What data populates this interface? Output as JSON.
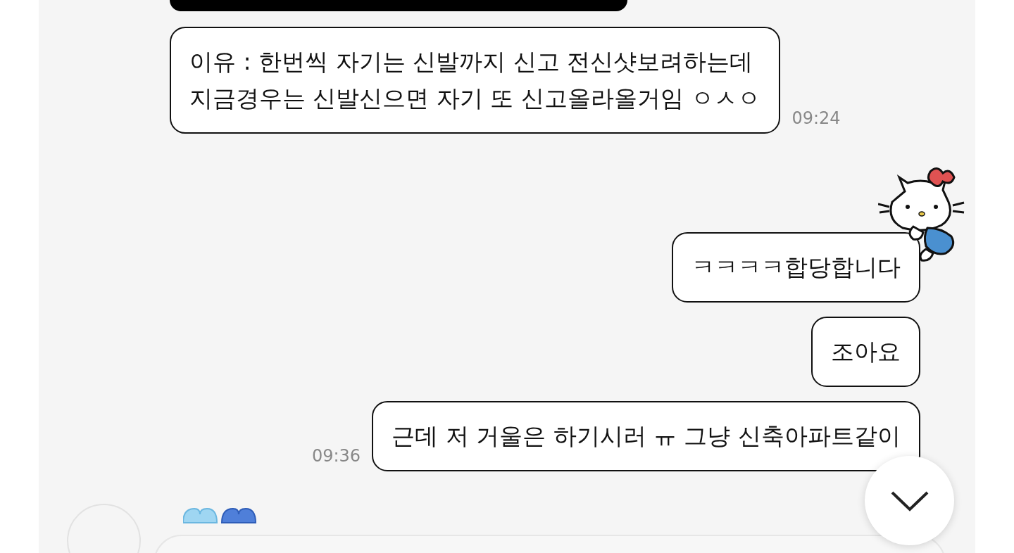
{
  "messages": [
    {
      "kind": "received",
      "lines": [
        "이유 : 한번씩 자기는 신발까지 신고 전신샷보려하는데",
        "지금경우는 신발신으면 자기 또 신고올라올거임 ㅇㅅㅇ"
      ],
      "time": "09:24"
    },
    {
      "kind": "sticker"
    },
    {
      "kind": "sent",
      "lines": [
        "ㅋㅋㅋㅋ합당합니다"
      ]
    },
    {
      "kind": "sent",
      "lines": [
        "조아요"
      ]
    },
    {
      "kind": "sent",
      "lines": [
        "근데 저 거울은 하기시러 ㅠ 그냥 신축아파트같이"
      ],
      "time": "09:36"
    }
  ]
}
